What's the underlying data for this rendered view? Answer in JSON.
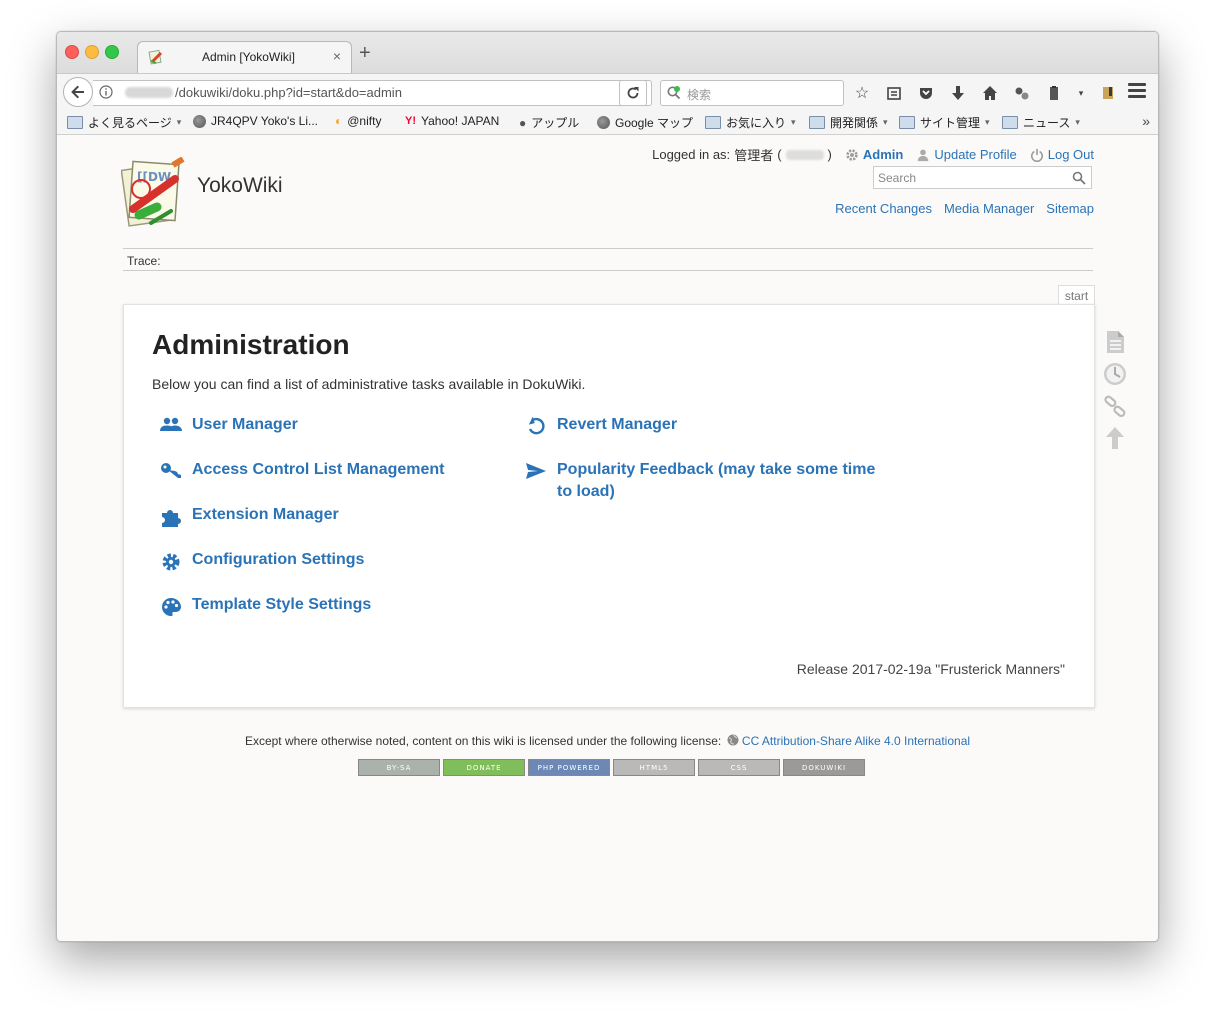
{
  "browser": {
    "tab_title": "Admin [YokoWiki]",
    "tab_close": "×",
    "new_tab": "+",
    "url_path": "/dokuwiki/doku.php?id=start&do=admin",
    "search_placeholder": "検索",
    "bookmarks": [
      {
        "label": "よく見るページ",
        "icon": "folder-icon",
        "menu": true
      },
      {
        "label": "JR4QPV Yoko's Li...",
        "icon": "globe-icon",
        "menu": false
      },
      {
        "label": "@nifty",
        "icon": "nifty-icon",
        "menu": false
      },
      {
        "label": "Yahoo! JAPAN",
        "icon": "yahoo-icon",
        "menu": false
      },
      {
        "label": "アップル",
        "icon": "apple-icon",
        "menu": false
      },
      {
        "label": "Google マップ",
        "icon": "globe-icon",
        "menu": false
      },
      {
        "label": "お気に入り",
        "icon": "folder-icon",
        "menu": true
      },
      {
        "label": "開発関係",
        "icon": "folder-icon",
        "menu": true
      },
      {
        "label": "サイト管理",
        "icon": "folder-icon",
        "menu": true
      },
      {
        "label": "ニュース",
        "icon": "folder-icon",
        "menu": true
      }
    ],
    "bookmarks_overflow": "»"
  },
  "wiki": {
    "site_title": "YokoWiki",
    "user": {
      "logged_in_label": "Logged in as:",
      "name": "管理者",
      "paren_open": "(",
      "paren_close": ")",
      "admin": "Admin",
      "update_profile": "Update Profile",
      "logout": "Log Out"
    },
    "search_placeholder": "Search",
    "site_tools": [
      "Recent Changes",
      "Media Manager",
      "Sitemap"
    ],
    "trace_label": "Trace:",
    "page_id": "start",
    "heading": "Administration",
    "intro": "Below you can find a list of administrative tasks available in DokuWiki.",
    "admin_tasks_left": [
      {
        "label": "User Manager",
        "icon": "users-icon"
      },
      {
        "label": "Access Control List Management",
        "icon": "key-icon"
      },
      {
        "label": "Extension Manager",
        "icon": "puzzle-icon"
      },
      {
        "label": "Configuration Settings",
        "icon": "gear-icon"
      },
      {
        "label": "Template Style Settings",
        "icon": "palette-icon"
      }
    ],
    "admin_tasks_right": [
      {
        "label": "Revert Manager",
        "icon": "revert-icon"
      },
      {
        "label": "Popularity Feedback (may take some time to load)",
        "icon": "send-icon"
      }
    ],
    "release": "Release 2017-02-19a \"Frusterick Manners\"",
    "license_text": "Except where otherwise noted, content on this wiki is licensed under the following license:",
    "license_link": "CC Attribution-Share Alike 4.0 International",
    "badges": [
      "BY-SA",
      "DONATE",
      "PHP POWERED",
      "HTML5",
      "CSS",
      "DOKUWIKI"
    ]
  },
  "colors": {
    "link": "#2b73b7",
    "page_bg": "#fbfaf8"
  }
}
